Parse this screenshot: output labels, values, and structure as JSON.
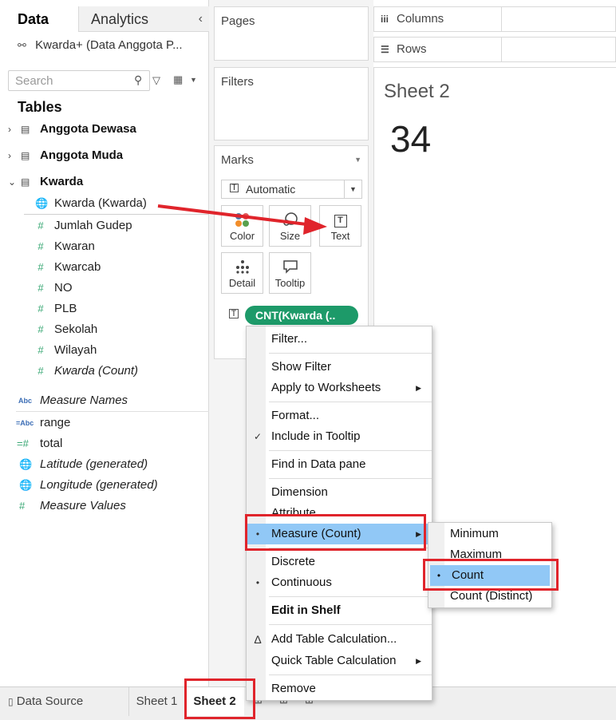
{
  "data_pane": {
    "tab_data": "Data",
    "tab_analytics": "Analytics",
    "datasource": "Kwarda+ (Data Anggota P...",
    "search_placeholder": "Search",
    "tables_heading": "Tables",
    "tables": [
      {
        "name": "Anggota Dewasa",
        "expanded": false
      },
      {
        "name": "Anggota Muda",
        "expanded": false
      },
      {
        "name": "Kwarda",
        "expanded": true
      }
    ],
    "kwarda_fields": [
      {
        "name": "Kwarda (Kwarda)",
        "icon": "globe-icon"
      },
      {
        "name": "Jumlah Gudep",
        "icon": "hash-icon"
      },
      {
        "name": "Kwaran",
        "icon": "hash-icon"
      },
      {
        "name": "Kwarcab",
        "icon": "hash-icon"
      },
      {
        "name": "NO",
        "icon": "hash-icon"
      },
      {
        "name": "PLB",
        "icon": "hash-icon"
      },
      {
        "name": "Sekolah",
        "icon": "hash-icon"
      },
      {
        "name": "Wilayah",
        "icon": "hash-icon"
      },
      {
        "name": "Kwarda (Count)",
        "icon": "hash-icon"
      }
    ],
    "measure_names": "Measure Names",
    "other_fields": [
      {
        "name": "range",
        "icon": "calc-abc-icon"
      },
      {
        "name": "total",
        "icon": "calc-hash-icon"
      },
      {
        "name": "Latitude (generated)",
        "icon": "globe-icon"
      },
      {
        "name": "Longitude (generated)",
        "icon": "globe-icon"
      },
      {
        "name": "Measure Values",
        "icon": "hash-icon"
      }
    ]
  },
  "shelves": {
    "pages": "Pages",
    "filters": "Filters",
    "marks": "Marks",
    "mark_type": "Automatic",
    "buttons": {
      "color": "Color",
      "size": "Size",
      "text": "Text",
      "detail": "Detail",
      "tooltip": "Tooltip"
    },
    "pill": "CNT(Kwarda (.."
  },
  "canvas": {
    "columns": "Columns",
    "rows": "Rows",
    "sheet_title": "Sheet 2",
    "value": "34"
  },
  "bottom_tabs": {
    "data_source": "Data Source",
    "sheet1": "Sheet 1",
    "sheet2": "Sheet 2"
  },
  "context_menu": {
    "filter": "Filter...",
    "show_filter": "Show Filter",
    "apply_to_worksheets": "Apply to Worksheets",
    "format": "Format...",
    "include_in_tooltip": "Include in Tooltip",
    "find_in_data_pane": "Find in Data pane",
    "dimension": "Dimension",
    "attribute": "Attribute",
    "measure_count": "Measure (Count)",
    "discrete": "Discrete",
    "continuous": "Continuous",
    "edit_in_shelf": "Edit in Shelf",
    "add_table_calc": "Add Table Calculation...",
    "quick_table_calc": "Quick Table Calculation",
    "remove": "Remove"
  },
  "submenu": {
    "minimum": "Minimum",
    "maximum": "Maximum",
    "count": "Count",
    "count_distinct": "Count (Distinct)"
  },
  "colors": {
    "pill_green": "#1d9a69",
    "highlight_blue": "#91c8f6",
    "annotation_red": "#e0242b"
  }
}
